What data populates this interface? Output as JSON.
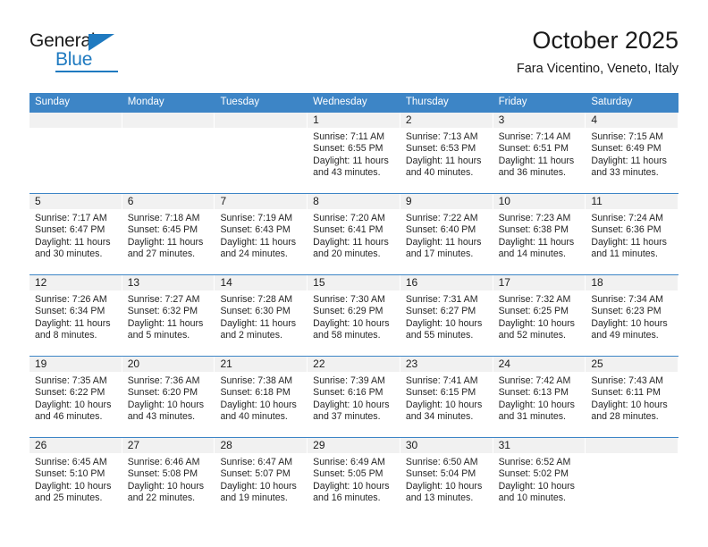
{
  "brand": {
    "name_top": "General",
    "name_bottom": "Blue",
    "accent_color": "#1f7ac0"
  },
  "header": {
    "month_title": "October 2025",
    "location": "Fara Vicentino, Veneto, Italy"
  },
  "theme": {
    "header_row_bg": "#3d85c6",
    "daynum_band_bg": "#f1f1f1",
    "text_color": "#262626",
    "page_bg": "#ffffff"
  },
  "weekdays": [
    "Sunday",
    "Monday",
    "Tuesday",
    "Wednesday",
    "Thursday",
    "Friday",
    "Saturday"
  ],
  "weeks": [
    [
      {
        "day": "",
        "lines": []
      },
      {
        "day": "",
        "lines": []
      },
      {
        "day": "",
        "lines": []
      },
      {
        "day": "1",
        "lines": [
          "Sunrise: 7:11 AM",
          "Sunset: 6:55 PM",
          "Daylight: 11 hours",
          "and 43 minutes."
        ]
      },
      {
        "day": "2",
        "lines": [
          "Sunrise: 7:13 AM",
          "Sunset: 6:53 PM",
          "Daylight: 11 hours",
          "and 40 minutes."
        ]
      },
      {
        "day": "3",
        "lines": [
          "Sunrise: 7:14 AM",
          "Sunset: 6:51 PM",
          "Daylight: 11 hours",
          "and 36 minutes."
        ]
      },
      {
        "day": "4",
        "lines": [
          "Sunrise: 7:15 AM",
          "Sunset: 6:49 PM",
          "Daylight: 11 hours",
          "and 33 minutes."
        ]
      }
    ],
    [
      {
        "day": "5",
        "lines": [
          "Sunrise: 7:17 AM",
          "Sunset: 6:47 PM",
          "Daylight: 11 hours",
          "and 30 minutes."
        ]
      },
      {
        "day": "6",
        "lines": [
          "Sunrise: 7:18 AM",
          "Sunset: 6:45 PM",
          "Daylight: 11 hours",
          "and 27 minutes."
        ]
      },
      {
        "day": "7",
        "lines": [
          "Sunrise: 7:19 AM",
          "Sunset: 6:43 PM",
          "Daylight: 11 hours",
          "and 24 minutes."
        ]
      },
      {
        "day": "8",
        "lines": [
          "Sunrise: 7:20 AM",
          "Sunset: 6:41 PM",
          "Daylight: 11 hours",
          "and 20 minutes."
        ]
      },
      {
        "day": "9",
        "lines": [
          "Sunrise: 7:22 AM",
          "Sunset: 6:40 PM",
          "Daylight: 11 hours",
          "and 17 minutes."
        ]
      },
      {
        "day": "10",
        "lines": [
          "Sunrise: 7:23 AM",
          "Sunset: 6:38 PM",
          "Daylight: 11 hours",
          "and 14 minutes."
        ]
      },
      {
        "day": "11",
        "lines": [
          "Sunrise: 7:24 AM",
          "Sunset: 6:36 PM",
          "Daylight: 11 hours",
          "and 11 minutes."
        ]
      }
    ],
    [
      {
        "day": "12",
        "lines": [
          "Sunrise: 7:26 AM",
          "Sunset: 6:34 PM",
          "Daylight: 11 hours",
          "and 8 minutes."
        ]
      },
      {
        "day": "13",
        "lines": [
          "Sunrise: 7:27 AM",
          "Sunset: 6:32 PM",
          "Daylight: 11 hours",
          "and 5 minutes."
        ]
      },
      {
        "day": "14",
        "lines": [
          "Sunrise: 7:28 AM",
          "Sunset: 6:30 PM",
          "Daylight: 11 hours",
          "and 2 minutes."
        ]
      },
      {
        "day": "15",
        "lines": [
          "Sunrise: 7:30 AM",
          "Sunset: 6:29 PM",
          "Daylight: 10 hours",
          "and 58 minutes."
        ]
      },
      {
        "day": "16",
        "lines": [
          "Sunrise: 7:31 AM",
          "Sunset: 6:27 PM",
          "Daylight: 10 hours",
          "and 55 minutes."
        ]
      },
      {
        "day": "17",
        "lines": [
          "Sunrise: 7:32 AM",
          "Sunset: 6:25 PM",
          "Daylight: 10 hours",
          "and 52 minutes."
        ]
      },
      {
        "day": "18",
        "lines": [
          "Sunrise: 7:34 AM",
          "Sunset: 6:23 PM",
          "Daylight: 10 hours",
          "and 49 minutes."
        ]
      }
    ],
    [
      {
        "day": "19",
        "lines": [
          "Sunrise: 7:35 AM",
          "Sunset: 6:22 PM",
          "Daylight: 10 hours",
          "and 46 minutes."
        ]
      },
      {
        "day": "20",
        "lines": [
          "Sunrise: 7:36 AM",
          "Sunset: 6:20 PM",
          "Daylight: 10 hours",
          "and 43 minutes."
        ]
      },
      {
        "day": "21",
        "lines": [
          "Sunrise: 7:38 AM",
          "Sunset: 6:18 PM",
          "Daylight: 10 hours",
          "and 40 minutes."
        ]
      },
      {
        "day": "22",
        "lines": [
          "Sunrise: 7:39 AM",
          "Sunset: 6:16 PM",
          "Daylight: 10 hours",
          "and 37 minutes."
        ]
      },
      {
        "day": "23",
        "lines": [
          "Sunrise: 7:41 AM",
          "Sunset: 6:15 PM",
          "Daylight: 10 hours",
          "and 34 minutes."
        ]
      },
      {
        "day": "24",
        "lines": [
          "Sunrise: 7:42 AM",
          "Sunset: 6:13 PM",
          "Daylight: 10 hours",
          "and 31 minutes."
        ]
      },
      {
        "day": "25",
        "lines": [
          "Sunrise: 7:43 AM",
          "Sunset: 6:11 PM",
          "Daylight: 10 hours",
          "and 28 minutes."
        ]
      }
    ],
    [
      {
        "day": "26",
        "lines": [
          "Sunrise: 6:45 AM",
          "Sunset: 5:10 PM",
          "Daylight: 10 hours",
          "and 25 minutes."
        ]
      },
      {
        "day": "27",
        "lines": [
          "Sunrise: 6:46 AM",
          "Sunset: 5:08 PM",
          "Daylight: 10 hours",
          "and 22 minutes."
        ]
      },
      {
        "day": "28",
        "lines": [
          "Sunrise: 6:47 AM",
          "Sunset: 5:07 PM",
          "Daylight: 10 hours",
          "and 19 minutes."
        ]
      },
      {
        "day": "29",
        "lines": [
          "Sunrise: 6:49 AM",
          "Sunset: 5:05 PM",
          "Daylight: 10 hours",
          "and 16 minutes."
        ]
      },
      {
        "day": "30",
        "lines": [
          "Sunrise: 6:50 AM",
          "Sunset: 5:04 PM",
          "Daylight: 10 hours",
          "and 13 minutes."
        ]
      },
      {
        "day": "31",
        "lines": [
          "Sunrise: 6:52 AM",
          "Sunset: 5:02 PM",
          "Daylight: 10 hours",
          "and 10 minutes."
        ]
      },
      {
        "day": "",
        "lines": []
      }
    ]
  ]
}
